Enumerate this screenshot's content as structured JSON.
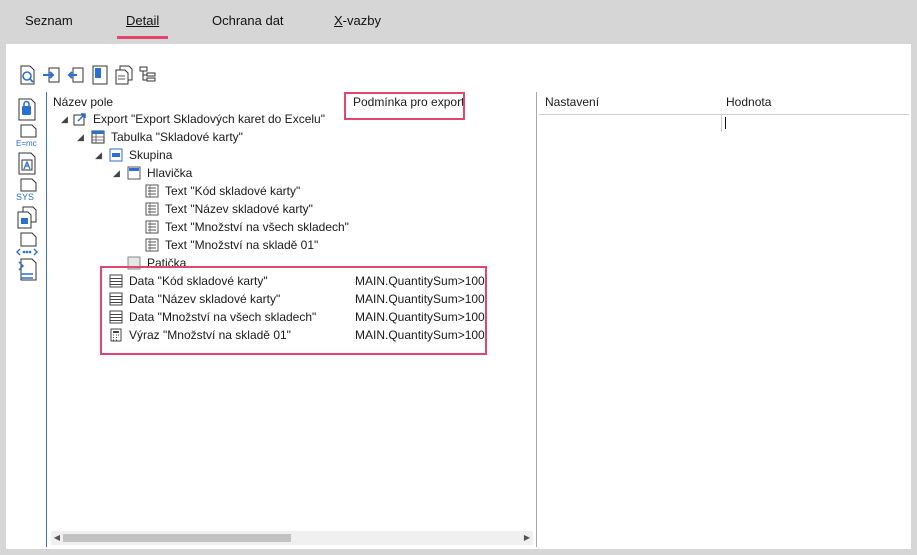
{
  "tabs": [
    {
      "label": "Seznam",
      "active": false
    },
    {
      "label": "Detail",
      "active": true
    },
    {
      "label": "Ochrana dat",
      "active": false
    },
    {
      "label_first": "X",
      "label_rest": "-vazby",
      "active": false
    }
  ],
  "toolbar": {
    "icons": [
      "preview-icon",
      "import-icon",
      "export-icon",
      "document-icon",
      "copy-icon",
      "tree-structure-icon"
    ]
  },
  "sidebar": {
    "icons": [
      "page-lock-icon",
      "formula-icon",
      "page-a-icon",
      "sys-variable-icon",
      "copy-pages-icon",
      "xml-icon",
      "insert-field-icon"
    ],
    "labels": {
      "formula": "E=mc",
      "sys": "SYS"
    }
  },
  "tree": {
    "header_name": "Název pole",
    "header_condition": "Podmínka pro export",
    "items": [
      {
        "label": "Export \"Export Skladových karet do Excelu\"",
        "condition": ""
      },
      {
        "label": "Tabulka \"Skladové karty\"",
        "condition": ""
      },
      {
        "label": "Skupina",
        "condition": ""
      },
      {
        "label": "Hlavička",
        "condition": ""
      },
      {
        "label": "Text \"Kód skladové karty\"",
        "condition": ""
      },
      {
        "label": "Text \"Název skladové karty\"",
        "condition": ""
      },
      {
        "label": "Text \"Množství na všech skladech\"",
        "condition": ""
      },
      {
        "label": "Text \"Množství na skladě 01\"",
        "condition": ""
      },
      {
        "label": "Patička",
        "condition": ""
      },
      {
        "label": "Data \"Kód skladové karty\"",
        "condition": "MAIN.QuantitySum>100"
      },
      {
        "label": "Data \"Název skladové karty\"",
        "condition": "MAIN.QuantitySum>100"
      },
      {
        "label": "Data \"Množství na všech skladech\"",
        "condition": "MAIN.QuantitySum>100"
      },
      {
        "label": "Výraz \"Množství na skladě 01\"",
        "condition": "MAIN.QuantitySum>100"
      }
    ]
  },
  "properties": {
    "header_setting": "Nastavení",
    "header_value": "Hodnota"
  },
  "colors": {
    "highlight": "#e0466e",
    "focus_border": "#3a72c6",
    "icon_blue": "#2a6fd1"
  }
}
